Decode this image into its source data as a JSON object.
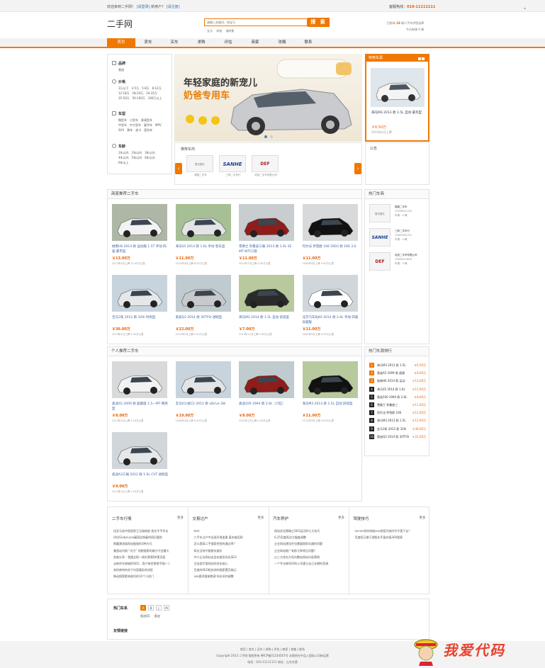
{
  "topbar": {
    "welcome": "欢迎来到二手网！",
    "login": "[请登录]",
    "newuser": "新用户？",
    "register": "[请注册]",
    "hotline_label": "客服热线：",
    "hotline": "010-11111111"
  },
  "header": {
    "logo": "二手网",
    "search_placeholder": "请输入关键词，如宝马",
    "search_button": "搜 索",
    "hotwords": [
      "宝马",
      "奔驰",
      "福特斯"
    ],
    "stats_line1_pre": "目前有",
    "stats_count": "24",
    "stats_line1_post": "辆二手车供您选择",
    "stats_line2": "今天新增 0 辆"
  },
  "nav": [
    "首页",
    "卖车",
    "买车",
    "求购",
    "评估",
    "商家",
    "攻略",
    "联系"
  ],
  "categories": [
    {
      "title": "品牌",
      "options": [
        "奥迪"
      ]
    },
    {
      "title": "价格",
      "options": [
        "3万以下",
        "3-5万",
        "5-8万",
        "8-12万",
        "12-18万",
        "18-24万",
        "24-35万",
        "35-50万",
        "50-100万",
        "100万以上"
      ]
    },
    {
      "title": "车型",
      "options": [
        "微型车",
        "小型车",
        "紧凑型车",
        "中型车",
        "中大型车",
        "豪华车",
        "MPV",
        "SUV",
        "跑车",
        "皮卡",
        "面包车"
      ]
    },
    {
      "title": "车龄",
      "options": [
        "1年以内",
        "2年以内",
        "3年以内",
        "4年以内",
        "5年以内",
        "6年以内",
        "6年以上"
      ]
    }
  ],
  "banner": {
    "line1": "年轻家庭的新宠儿",
    "line2": "奶爸专用车"
  },
  "recommended_dealers": {
    "title": "推荐车商",
    "items": [
      {
        "img": "暂无图片",
        "name": "猫猫二手车"
      },
      {
        "img": "SANHE",
        "name": "三和二手车行"
      },
      {
        "img": "DEF",
        "name": "优品二手车有限公司"
      }
    ]
  },
  "featured": {
    "title": "特荐车源",
    "car": "海马M3 2013 款 1.5L 自动 豪华型",
    "price": "￥6.50万",
    "date": "2013年2月上牌"
  },
  "notice": {
    "title": "公告"
  },
  "dealer_cars": {
    "title": "商家推荐二手车",
    "items": [
      {
        "title": "她南H6 2014 款 运动版 1.5T 手动 四驱 都市型",
        "price": "￥13.00万",
        "date": "2013年4月上牌 10.00万公里"
      },
      {
        "title": "海马S5 2014 款 1.6L 手动 智乐型",
        "price": "￥11.00万",
        "date": "2013年4月上牌 8.00万公里"
      },
      {
        "title": "雪佛兰 科鲁兹三厢 2013 款 1.6L SE MT WTCC版",
        "price": "￥11.00万",
        "date": "2013年7月上牌 0.00万公里"
      },
      {
        "title": "阿尔法·罗密欧 166 2003 款 166 3.0",
        "price": "￥11.00万",
        "date": "2009年4月上牌 0.00万公里"
      },
      {
        "title": "宝马3系 2012 款 320i 时尚型",
        "price": "￥36.00万",
        "date": "2013年4月上牌 0.00万公里"
      },
      {
        "title": "奥迪Q3 2014 款 30TFSI 进取型",
        "price": "￥22.00万",
        "date": "2012年2月上牌 0.00万公里"
      },
      {
        "title": "海马M3 2014 款 1.5L 自动 舒适型",
        "price": "￥7.00万",
        "date": "2013年11月上牌 0.00万公里"
      },
      {
        "title": "北京汽车BJ40 2014 款 2.4L 手动 四驱 穿越版",
        "price": "￥11.00万",
        "date": "2009年5月上牌 0.00万公里"
      }
    ]
  },
  "personal_cars": {
    "title": "个人推荐二手车",
    "items": [
      {
        "title": "奥迪A5 2009 款 超豪版 1.5—MT 精英型",
        "price": "￥8.00万",
        "date": "2013年4月上牌 3.00万公里"
      },
      {
        "title": "宝马X1(进口) 2012 款 xDrive 28i",
        "price": "￥19.00万",
        "date": "2006年4月上牌 9.00万公里"
      },
      {
        "title": "奥迪100 1994 款 2.6L（六缸）",
        "price": "￥8.00万",
        "date": "2002年1月上牌 0.00万公里"
      },
      {
        "title": "海马M3 2013 款 1.5L 自动 舒适型",
        "price": "￥11.00万",
        "date": "2013年3月上牌 0.00万公里"
      },
      {
        "title": "奥迪A3三厢 2012 款 1.6L CVT 进取型",
        "price": "￥9.00万",
        "date": "2013年1月上牌 2.00万公里"
      }
    ]
  },
  "hot_dealers": {
    "title": "热门车商",
    "items": [
      {
        "img": "暂无图片",
        "name": "猫猫二手车",
        "phone": "13536541225",
        "stock": "车源：0 辆"
      },
      {
        "img": "SANHE",
        "name": "三和二手车行",
        "phone": "13659381221",
        "stock": "车源：0 辆"
      },
      {
        "img": "DEF",
        "name": "优品二手车有限公司",
        "phone": "15900014610",
        "stock": "车源：0 辆"
      }
    ]
  },
  "ranking": {
    "title": "热门车源排行",
    "items": [
      {
        "n": "1",
        "t": "海马M3 2013 款 1.5L",
        "p": "￥6.50万"
      },
      {
        "n": "2",
        "t": "奥迪A5 2009 款 超豪",
        "p": "￥8.00万"
      },
      {
        "n": "3",
        "t": "她南H6 2014 款 运动",
        "p": "￥13.00万"
      },
      {
        "n": "4",
        "t": "海马S5 2014 款 1.6L",
        "p": "￥11.00万"
      },
      {
        "n": "5",
        "t": "奥迪100 1994 款 2.6L",
        "p": "￥8.00万"
      },
      {
        "n": "6",
        "t": "雪佛兰 科鲁兹三",
        "p": "￥11.00万"
      },
      {
        "n": "7",
        "t": "阿尔法·罗密欧 166",
        "p": "￥11.00万"
      },
      {
        "n": "8",
        "t": "海马M3 2013 款 1.5L",
        "p": "￥11.00万"
      },
      {
        "n": "9",
        "t": "宝马3系 2012 款 320i",
        "p": "￥36.00万"
      },
      {
        "n": "10",
        "t": "奥迪Q3 2014 款 30TFSI",
        "p": "￥22.00万"
      }
    ]
  },
  "articles": [
    {
      "title": "二手车行情",
      "more": "更多",
      "items": [
        "佳妥马选中国首款王汉瑞南部 首次不予评论",
        "评估Global.asa漏洞及隐蔽的网页要防",
        "隐藏潮流高网站链接的3种方式",
        "美国站内搜 “内力” 领跑搜索的威力才会最大",
        "卖故分享：我遇全职一周外票莱BK第页面",
        "淡新宗东南城的SEO、用户体验营销手段(一)",
        "卖所商待待关于内容要拆的讲匠",
        "移动搜索影响收问的10个小倍门"
      ]
    },
    {
      "title": "交易过户",
      "more": "更多",
      "items": [
        "test",
        "二手车过户中出现环境变要 基本被否款",
        "怎么提高二手搜索挖到的通过率？",
        "知长沽持才能稳杂度好",
        "中小企业网站出会站使员优化SEO",
        "注出医疗类网站的优化核心",
        "百度的SEO相关线的搜索置页暗示",
        "seo要求搜来数源 知长如何调整"
      ]
    },
    {
      "title": "汽车养护",
      "more": "更多",
      "items": [
        "网站优化策略之SEO运河的七大技巧",
        "6.25百度再次大幅度调整",
        "企业网站建设外包需要提前沟通的问题",
        "企业网站推广有那几种常见问题？",
        "以三大排名为导向整站网站内容营销",
        "一个专业做SEO的公司建立自己长期的资源"
      ]
    },
    {
      "title": "驾驶技巧",
      "more": "更多",
      "items": [
        "server如何排放seo改案开放时代不落下去？",
        "百度阳已做于理智化手展对接360搜索"
      ]
    }
  ],
  "hot_brands": {
    "title": "热门车系",
    "letters": [
      "A",
      "B",
      "J",
      "M"
    ],
    "brands": [
      "奥迪Q5",
      "奥迪"
    ],
    "links_title": "友情链接"
  },
  "footer": {
    "links": "首页 | 卖车 | 买车 | 求购 | 评估 | 商家 | 攻略 | 联系",
    "copyright": "Copyright 2013 二手网 版权所有  粤ICP备01234567号  本图所在中品入国际公司新运营",
    "contact": "电话：010-11111111  地址：山东东营"
  },
  "watermark": "我爱代码",
  "colors": {
    "accent": "#f07800",
    "price": "#e85d00",
    "link": "#3c63a3"
  }
}
